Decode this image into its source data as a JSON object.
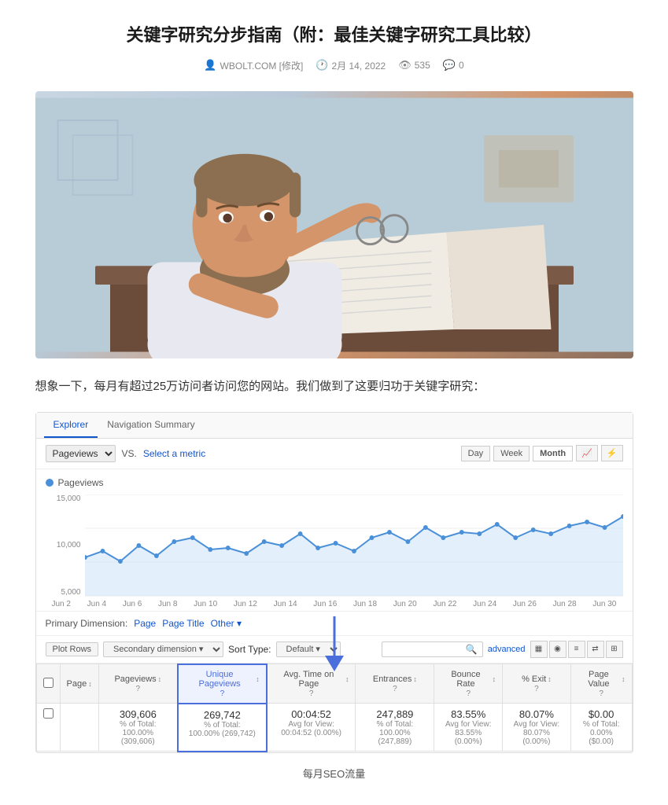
{
  "title": "关键字研究分步指南（附：最佳关键字研究工具比较）",
  "meta": {
    "author": "WBOLT.COM [修改]",
    "date": "2月 14, 2022",
    "views": "535",
    "comments": "0"
  },
  "intro_text": "想象一下，每月有超过25万访问者访问您的网站。我们做到了这要归功于关键字研究：",
  "analytics": {
    "tabs": [
      "Explorer",
      "Navigation Summary"
    ],
    "active_tab": "Explorer",
    "metric_label": "Pageviews",
    "vs_label": "VS.",
    "select_metric": "Select a metric",
    "time_buttons": [
      "Day",
      "Week",
      "Month"
    ],
    "active_time": "Month",
    "chart": {
      "legend": "Pageviews",
      "y_labels": [
        "15,000",
        "10,000",
        "5,000"
      ],
      "x_labels": [
        "Jun 2",
        "Jun 4",
        "Jun 6",
        "Jun 8",
        "Jun 10",
        "Jun 12",
        "Jun 14",
        "Jun 16",
        "Jun 18",
        "Jun 20",
        "Jun 22",
        "Jun 24",
        "Jun 26",
        "Jun 28",
        "Jun 30"
      ]
    },
    "primary_dimension": {
      "label": "Primary Dimension:",
      "options": [
        "Page",
        "Page Title",
        "Other"
      ]
    },
    "filter_bar": {
      "plot_rows": "Plot Rows",
      "secondary_dim": "Secondary dimension ▼",
      "sort_type": "Sort Type:",
      "sort_default": "Default ▼",
      "search_placeholder": ""
    },
    "table": {
      "columns": [
        "Page",
        "Pageviews",
        "Unique Pageviews",
        "Avg. Time on Page",
        "Entrances",
        "Bounce Rate",
        "% Exit",
        "Page Value"
      ],
      "highlighted_column": "Unique Pageviews",
      "rows": [
        {
          "page": "",
          "pageviews": "309,606",
          "pageviews_sub": "% of Total:\n100.00% (309,606)",
          "unique_pageviews": "269,742",
          "unique_pageviews_sub": "% of Total:\n100.00% (269,742)",
          "avg_time": "00:04:52",
          "avg_time_sub": "Avg for View:\n00:04:52 (0.00%)",
          "entrances": "247,889",
          "entrances_sub": "% of Total:\n100.00% (247,889)",
          "bounce_rate": "83.55%",
          "bounce_rate_sub": "Avg for View:\n83.55% (0.00%)",
          "exit": "80.07%",
          "exit_sub": "Avg for View:\n80.07% (0.00%)",
          "page_value": "$0.00",
          "page_value_sub": "% of Total:\n0.00% ($0.00)"
        }
      ]
    }
  },
  "monthly_label": "每月SEO流量",
  "arrow": {
    "color": "#4a6fdc"
  }
}
